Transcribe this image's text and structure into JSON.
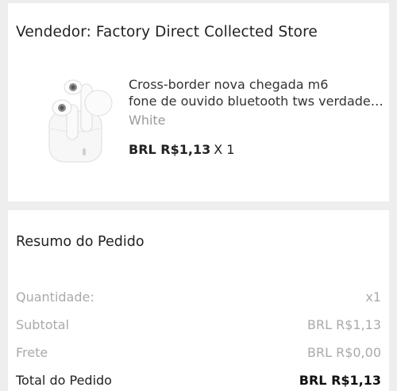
{
  "seller": {
    "label": "Vendedor: Factory Direct Collected Store"
  },
  "product": {
    "title": "Cross-border nova chegada m6\nfone de ouvido bluetooth tws verdade…",
    "variant": "White",
    "price": "BRL R$1,13",
    "quantity": "X 1",
    "image_icon": "earbuds-product-image"
  },
  "summary": {
    "title": "Resumo do Pedido",
    "rows": [
      {
        "label": "Quantidade:",
        "value": "x1"
      },
      {
        "label": "Subtotal",
        "value": "BRL R$1,13"
      },
      {
        "label": "Frete",
        "value": "BRL R$0,00"
      }
    ],
    "total": {
      "label": "Total do Pedido",
      "value": "BRL R$1,13"
    }
  },
  "colors": {
    "background": "#eeeeee",
    "card": "#ffffff",
    "muted_text": "#aaaaaa",
    "primary_text": "#222222"
  }
}
